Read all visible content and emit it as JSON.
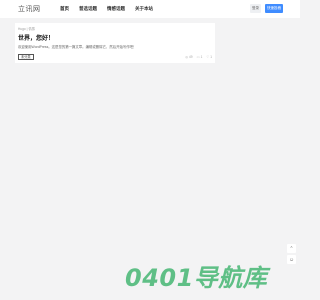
{
  "header": {
    "logo": "立讯网",
    "nav": [
      "首页",
      "普选话题",
      "情感话题",
      "关于本站"
    ],
    "login_label": "登录",
    "submit_label": "快速投稿"
  },
  "post": {
    "author": "Hugo",
    "category": "情感",
    "title": "世界，您好！",
    "excerpt": "欢迎使用WordPress。这是您的第一篇文章。编辑或删除它，然后开始写作吧！",
    "tag": "未分类",
    "views": "49",
    "comments": "1",
    "likes": "1",
    "views_icon": "eye-icon",
    "comments_icon": "comment-icon",
    "likes_icon": "heart-icon"
  },
  "floating": {
    "top_icon": "scroll-top-icon",
    "chat_icon": "chat-icon"
  },
  "watermark": "0401导航库",
  "colors": {
    "accent": "#3f8cff",
    "watermark": "#5fbf86"
  }
}
